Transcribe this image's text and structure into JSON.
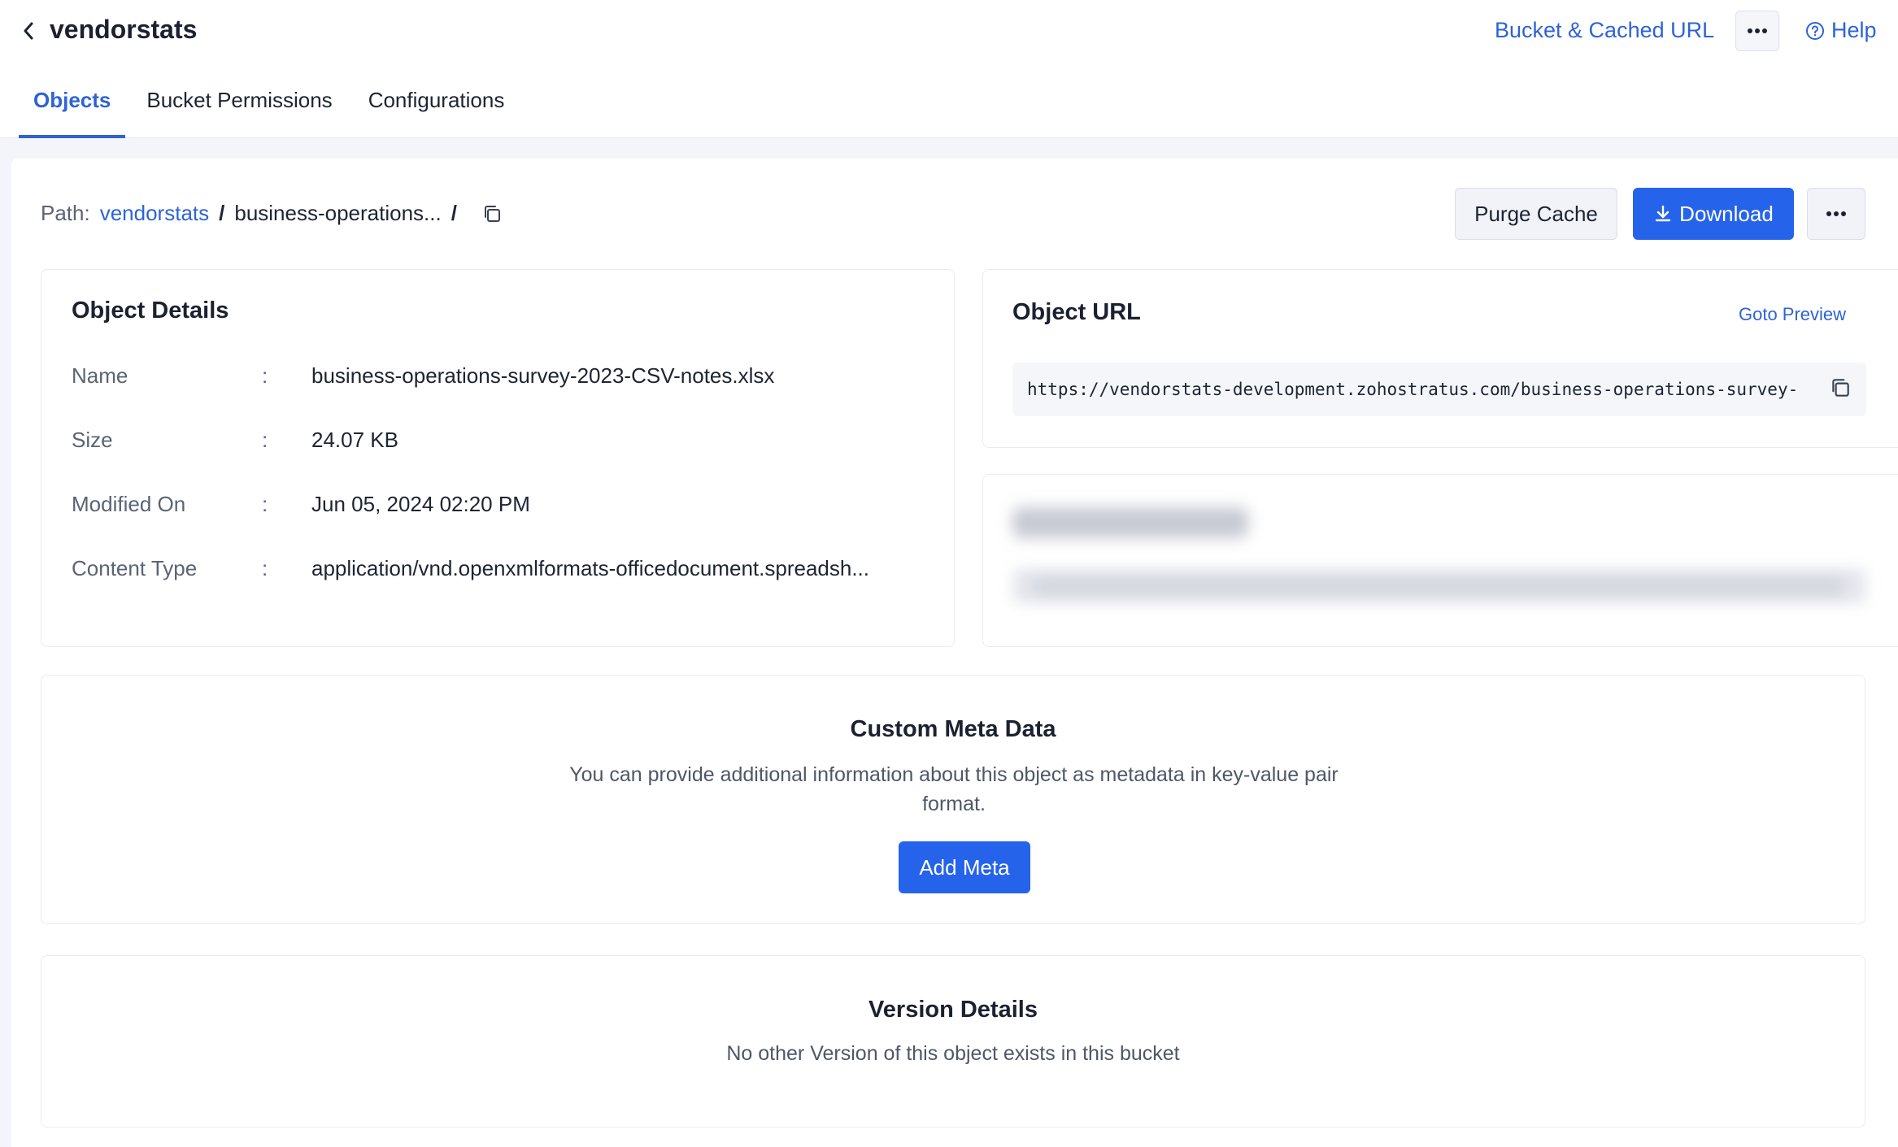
{
  "header": {
    "back_icon": "chevron-left-icon",
    "title": "vendorstats",
    "bucket_link": "Bucket & Cached URL",
    "more_icon": "ellipsis-icon",
    "help_label": "Help",
    "help_icon": "question-circle-icon"
  },
  "tabs": [
    {
      "label": "Objects",
      "active": true
    },
    {
      "label": "Bucket Permissions",
      "active": false
    },
    {
      "label": "Configurations",
      "active": false
    }
  ],
  "path": {
    "label": "Path:",
    "root": "vendorstats",
    "separator": "/",
    "segment": "business-operations...",
    "copy_icon": "copy-icon"
  },
  "actions": {
    "purge_label": "Purge Cache",
    "download_label": "Download",
    "download_icon": "download-icon",
    "more_icon": "ellipsis-icon"
  },
  "object_details": {
    "title": "Object Details",
    "separator": ":",
    "rows": [
      {
        "key": "Name",
        "value": "business-operations-survey-2023-CSV-notes.xlsx"
      },
      {
        "key": "Size",
        "value": "24.07 KB"
      },
      {
        "key": "Modified On",
        "value": "Jun 05, 2024 02:20 PM"
      },
      {
        "key": "Content Type",
        "value": "application/vnd.openxmlformats-officedocument.spreadsh..."
      }
    ]
  },
  "object_url": {
    "title": "Object URL",
    "goto_label": "Goto Preview",
    "url": "https://vendorstats-development.zohostratus.com/business-operations-survey-",
    "copy_icon": "copy-icon"
  },
  "custom_meta": {
    "title": "Custom Meta Data",
    "description": "You can provide additional information about this object as metadata in key-value pair format.",
    "button_label": "Add Meta"
  },
  "version_details": {
    "title": "Version Details",
    "description": "No other Version of this object exists in this bucket"
  },
  "colors": {
    "accent": "#2563eb",
    "link": "#2e63d6",
    "page_bg": "#f3f5fb"
  }
}
